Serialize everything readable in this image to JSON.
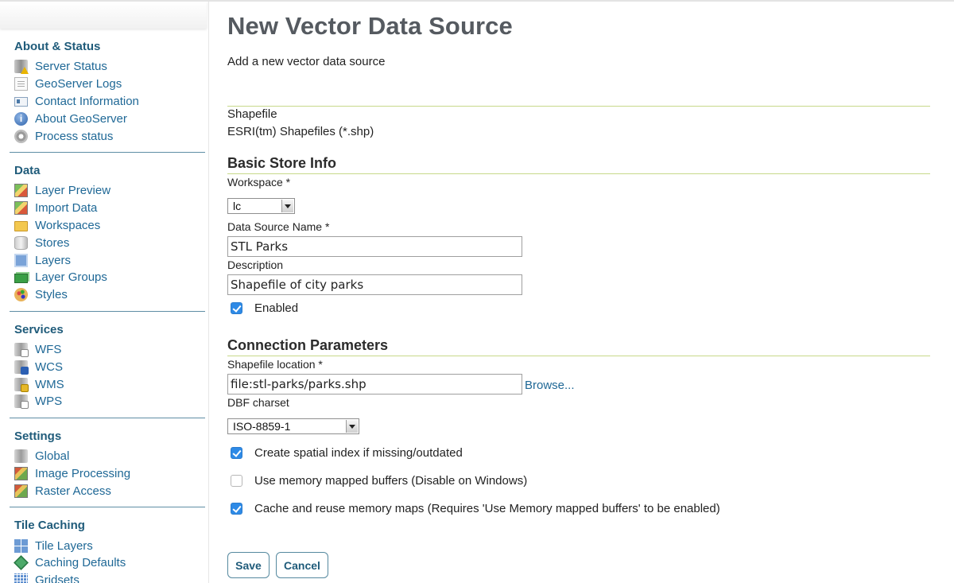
{
  "sidebar": {
    "sections": [
      {
        "heading": "About & Status",
        "items": [
          {
            "label": "Server Status",
            "icon": "server-status-icon"
          },
          {
            "label": "GeoServer Logs",
            "icon": "logs-icon"
          },
          {
            "label": "Contact Information",
            "icon": "contact-card-icon"
          },
          {
            "label": "About GeoServer",
            "icon": "info-icon"
          },
          {
            "label": "Process status",
            "icon": "gear-icon"
          }
        ]
      },
      {
        "heading": "Data",
        "items": [
          {
            "label": "Layer Preview",
            "icon": "map-icon"
          },
          {
            "label": "Import Data",
            "icon": "import-map-icon"
          },
          {
            "label": "Workspaces",
            "icon": "folder-icon"
          },
          {
            "label": "Stores",
            "icon": "database-icon"
          },
          {
            "label": "Layers",
            "icon": "layer-icon"
          },
          {
            "label": "Layer Groups",
            "icon": "layer-group-icon"
          },
          {
            "label": "Styles",
            "icon": "palette-icon"
          }
        ]
      },
      {
        "heading": "Services",
        "items": [
          {
            "label": "WFS",
            "icon": "wfs-service-icon"
          },
          {
            "label": "WCS",
            "icon": "wcs-service-icon"
          },
          {
            "label": "WMS",
            "icon": "wms-service-icon"
          },
          {
            "label": "WPS",
            "icon": "wps-service-icon"
          }
        ]
      },
      {
        "heading": "Settings",
        "items": [
          {
            "label": "Global",
            "icon": "global-settings-icon"
          },
          {
            "label": "Image Processing",
            "icon": "image-processing-icon"
          },
          {
            "label": "Raster Access",
            "icon": "raster-access-icon"
          }
        ]
      },
      {
        "heading": "Tile Caching",
        "items": [
          {
            "label": "Tile Layers",
            "icon": "tile-layers-icon"
          },
          {
            "label": "Caching Defaults",
            "icon": "caching-defaults-icon"
          },
          {
            "label": "Gridsets",
            "icon": "gridsets-icon"
          }
        ]
      }
    ]
  },
  "main": {
    "title": "New Vector Data Source",
    "description": "Add a new vector data source",
    "store_type": "Shapefile",
    "store_type_desc": "ESRI(tm) Shapefiles (*.shp)",
    "basic_heading": "Basic Store Info",
    "workspace_label": "Workspace *",
    "workspace_value": "lc",
    "name_label": "Data Source Name *",
    "name_value": "STL Parks",
    "description_label": "Description",
    "description_value": "Shapefile of city parks",
    "enabled_label": "Enabled",
    "enabled": true,
    "connection_heading": "Connection Parameters",
    "location_label": "Shapefile location *",
    "location_value": "file:stl-parks/parks.shp",
    "browse_label": "Browse...",
    "charset_label": "DBF charset",
    "charset_value": "ISO-8859-1",
    "options": [
      {
        "label": "Create spatial index if missing/outdated",
        "checked": true
      },
      {
        "label": "Use memory mapped buffers (Disable on Windows)",
        "checked": false
      },
      {
        "label": "Cache and reuse memory maps (Requires 'Use Memory mapped buffers' to be enabled)",
        "checked": true
      }
    ],
    "save_label": "Save",
    "cancel_label": "Cancel"
  },
  "colors": {
    "link": "#1f6896",
    "heading": "#1f5b7a",
    "checkbox": "#2e8ae6",
    "rule": "#c7d98a"
  }
}
